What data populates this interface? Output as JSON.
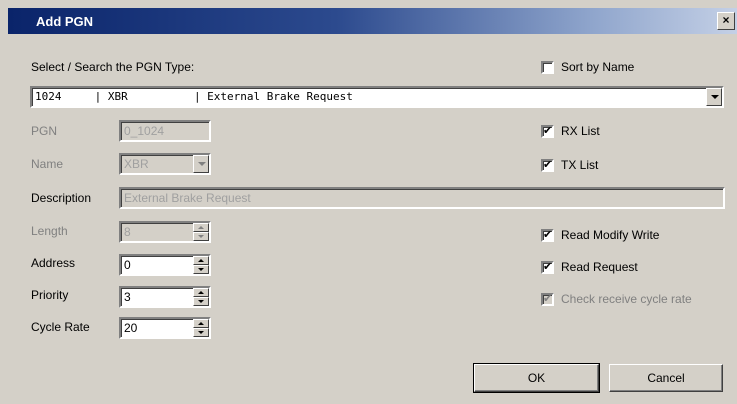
{
  "window": {
    "title": "Add PGN",
    "close_glyph": "×"
  },
  "search": {
    "label": "Select / Search the PGN Type:"
  },
  "pgn_type": {
    "value": "1024     | XBR          | External Brake Request"
  },
  "sort_by_name": {
    "label": "Sort by Name",
    "checked": false
  },
  "fields": {
    "pgn": {
      "label": "PGN",
      "value": "0_1024"
    },
    "name": {
      "label": "Name",
      "value": "XBR"
    },
    "description": {
      "label": "Description",
      "value": "External Brake Request"
    },
    "length": {
      "label": "Length",
      "value": "8"
    },
    "address": {
      "label": "Address",
      "value": "0"
    },
    "priority": {
      "label": "Priority",
      "value": "3"
    },
    "cycle_rate": {
      "label": "Cycle Rate",
      "value": "20"
    }
  },
  "options": {
    "rx_list": {
      "label": "RX List",
      "checked": true
    },
    "tx_list": {
      "label": "TX List",
      "checked": true
    },
    "read_modify_write": {
      "label": "Read Modify Write",
      "checked": true
    },
    "read_request": {
      "label": "Read Request",
      "checked": true
    },
    "check_receive_cycle": {
      "label": "Check receive cycle rate",
      "checked": true
    }
  },
  "buttons": {
    "ok": "OK",
    "cancel": "Cancel"
  },
  "check_glyph": "✔",
  "colors": {
    "dialog_bg": "#d4d0c8",
    "title_start": "#0a246a",
    "disabled_text": "#808080"
  }
}
